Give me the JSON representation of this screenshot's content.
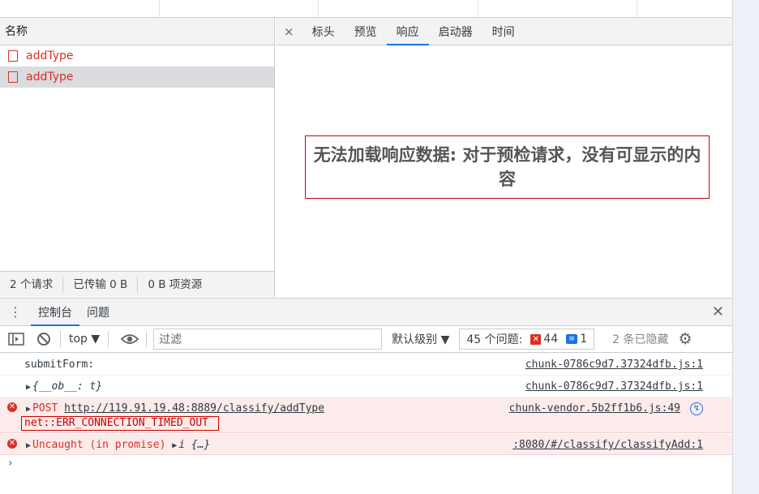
{
  "network": {
    "name_header": "名称",
    "requests": [
      {
        "name": "addType"
      },
      {
        "name": "addType"
      }
    ],
    "status": {
      "requests": "2 个请求",
      "transferred": "已传输 0 B",
      "resources": "0 B 项资源"
    }
  },
  "detail": {
    "close": "×",
    "tabs": [
      "标头",
      "预览",
      "响应",
      "启动器",
      "时间"
    ],
    "active_tab": "响应",
    "message": "无法加载响应数据: 对于预检请求，没有可显示的内容"
  },
  "drawer": {
    "menu": "⋮",
    "tabs": [
      "控制台",
      "问题"
    ],
    "active_tab": "控制台",
    "close": "✕"
  },
  "toolbar": {
    "context": "top ▼",
    "filter_placeholder": "过滤",
    "levels": "默认级别 ▼",
    "issues_label": "45 个问题:",
    "errors": "44",
    "infos": "1",
    "hidden": "2 条已隐藏"
  },
  "console": {
    "m1_text": "submitForm:",
    "m1_src": "chunk-0786c9d7.37324dfb.js:1",
    "m2_text": "{__ob__: t}",
    "m2_src": "chunk-0786c9d7.37324dfb.js:1",
    "m3_method": "POST ",
    "m3_url": "http://119.91.19.48:8889/classify/addType",
    "m3_src": "chunk-vendor.5b2ff1b6.js:49",
    "m3_error": "net::ERR_CONNECTION_TIMED_OUT",
    "m4_text": "Uncaught (in promise) ",
    "m4_obj": "i {…}",
    "m4_src": ":8080/#/classify/classifyAdd:1",
    "prompt": "›"
  },
  "colors": {
    "accent": "#1a73e8",
    "error": "#d93025",
    "error_bg": "#fcebeb"
  }
}
